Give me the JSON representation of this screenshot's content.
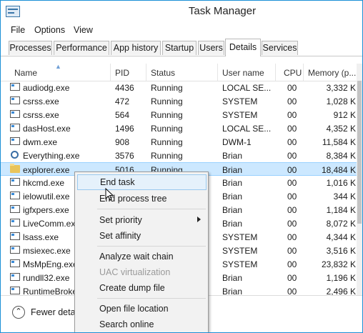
{
  "window": {
    "title": "Task Manager",
    "icon": "task-manager-icon"
  },
  "menu": [
    "File",
    "Options",
    "View"
  ],
  "tabs": [
    "Processes",
    "Performance",
    "App history",
    "Startup",
    "Users",
    "Details",
    "Services"
  ],
  "active_tab": "Details",
  "columns": [
    "Name",
    "PID",
    "Status",
    "User name",
    "CPU",
    "Memory (p..."
  ],
  "rows": [
    {
      "name": "audiodg.exe",
      "pid": "4436",
      "status": "Running",
      "user": "LOCAL SE...",
      "cpu": "00",
      "memory": "3,332 K"
    },
    {
      "name": "csrss.exe",
      "pid": "472",
      "status": "Running",
      "user": "SYSTEM",
      "cpu": "00",
      "memory": "1,028 K"
    },
    {
      "name": "csrss.exe",
      "pid": "564",
      "status": "Running",
      "user": "SYSTEM",
      "cpu": "00",
      "memory": "912 K"
    },
    {
      "name": "dasHost.exe",
      "pid": "1496",
      "status": "Running",
      "user": "LOCAL SE...",
      "cpu": "00",
      "memory": "4,352 K"
    },
    {
      "name": "dwm.exe",
      "pid": "908",
      "status": "Running",
      "user": "DWM-1",
      "cpu": "00",
      "memory": "11,584 K"
    },
    {
      "name": "Everything.exe",
      "pid": "3576",
      "status": "Running",
      "user": "Brian",
      "cpu": "00",
      "memory": "8,384 K"
    },
    {
      "name": "explorer.exe",
      "pid": "5016",
      "status": "Running",
      "user": "Brian",
      "cpu": "00",
      "memory": "18,484 K"
    },
    {
      "name": "hkcmd.exe",
      "pid": "",
      "status": "",
      "user": "Brian",
      "cpu": "00",
      "memory": "1,016 K"
    },
    {
      "name": "ielowutil.exe",
      "pid": "",
      "status": "",
      "user": "Brian",
      "cpu": "00",
      "memory": "344 K"
    },
    {
      "name": "igfxpers.exe",
      "pid": "",
      "status": "",
      "user": "Brian",
      "cpu": "00",
      "memory": "1,184 K"
    },
    {
      "name": "LiveComm.exe",
      "pid": "",
      "status": "",
      "user": "Brian",
      "cpu": "00",
      "memory": "8,072 K"
    },
    {
      "name": "lsass.exe",
      "pid": "",
      "status": "",
      "user": "SYSTEM",
      "cpu": "00",
      "memory": "4,344 K"
    },
    {
      "name": "msiexec.exe",
      "pid": "",
      "status": "",
      "user": "SYSTEM",
      "cpu": "00",
      "memory": "3,516 K"
    },
    {
      "name": "MsMpEng.exe",
      "pid": "",
      "status": "",
      "user": "SYSTEM",
      "cpu": "00",
      "memory": "23,832 K"
    },
    {
      "name": "rundll32.exe",
      "pid": "",
      "status": "",
      "user": "Brian",
      "cpu": "00",
      "memory": "1,196 K"
    },
    {
      "name": "RuntimeBroker.exe",
      "pid": "",
      "status": "",
      "user": "Brian",
      "cpu": "00",
      "memory": "2,496 K"
    }
  ],
  "selected_row": "explorer.exe",
  "footer": {
    "fewer_details": "Fewer detai"
  },
  "context_menu": {
    "items": [
      {
        "label": "End task",
        "state": "hover"
      },
      {
        "label": "End process tree"
      },
      {
        "label": "Set priority",
        "submenu": true
      },
      {
        "label": "Set affinity"
      },
      {
        "label": "Analyze wait chain"
      },
      {
        "label": "UAC virtualization",
        "state": "disabled"
      },
      {
        "label": "Create dump file"
      },
      {
        "label": "Open file location"
      },
      {
        "label": "Search online"
      }
    ]
  },
  "colors": {
    "accent": "#1b8fd6",
    "selection": "#cce8ff",
    "menu_bg": "#f2f2f2",
    "menu_hover": "#e5f1fb"
  }
}
